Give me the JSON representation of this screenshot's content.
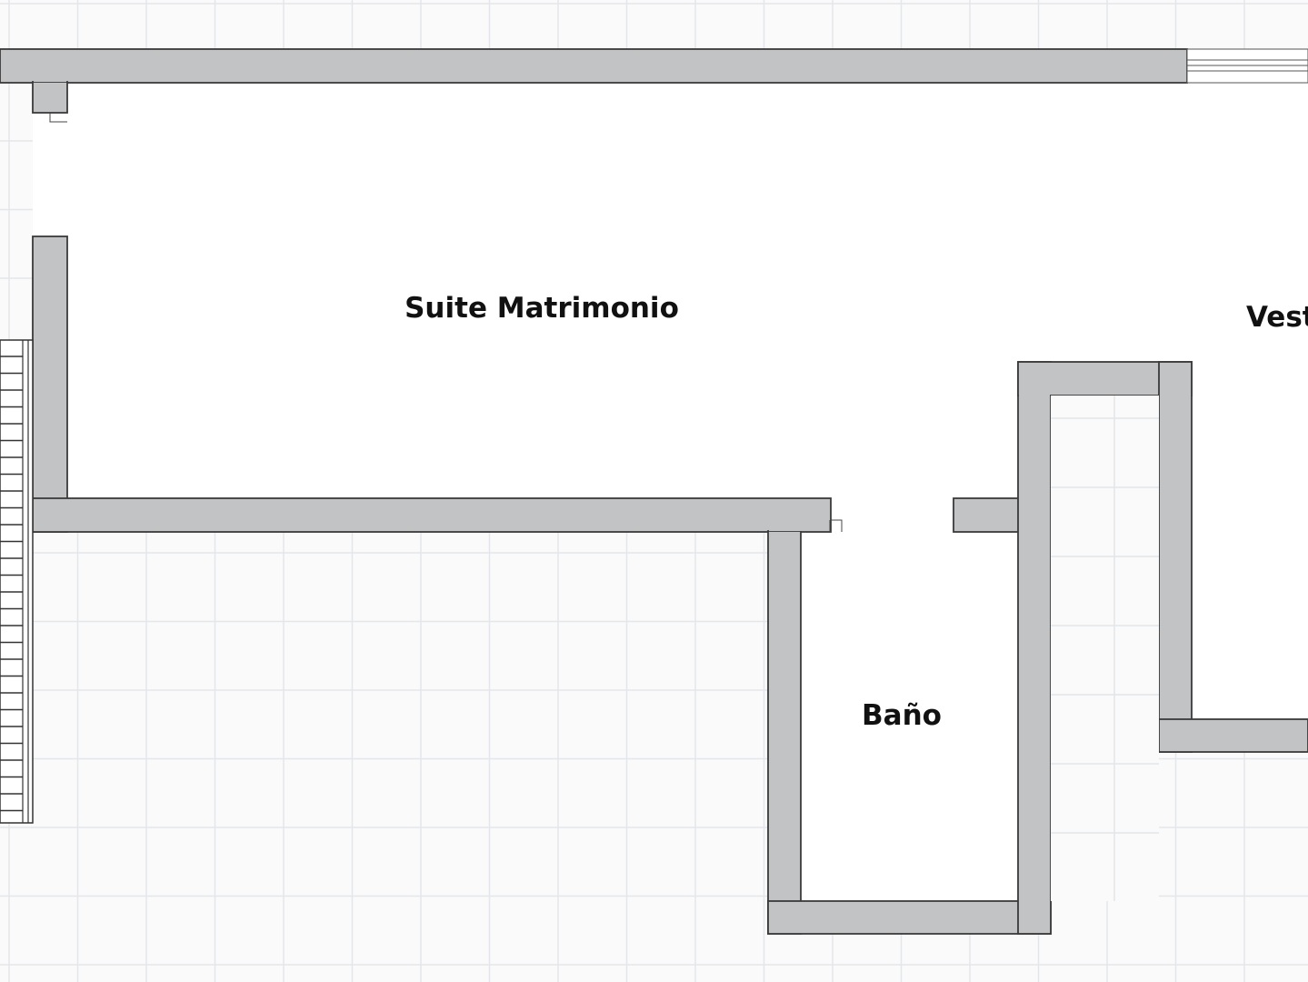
{
  "floor_plan": {
    "rooms": [
      {
        "id": "suite",
        "label": "Suite Matrimonio"
      },
      {
        "id": "bano",
        "label": "Baño"
      },
      {
        "id": "vestidor",
        "label": "Vest"
      }
    ],
    "colors": {
      "background": "#fafafa",
      "grid_line": "#e3e6ea",
      "wall_fill": "#c2c3c5",
      "wall_stroke": "#3a3a3a",
      "room_fill": "#ffffff",
      "label": "#111111"
    }
  }
}
